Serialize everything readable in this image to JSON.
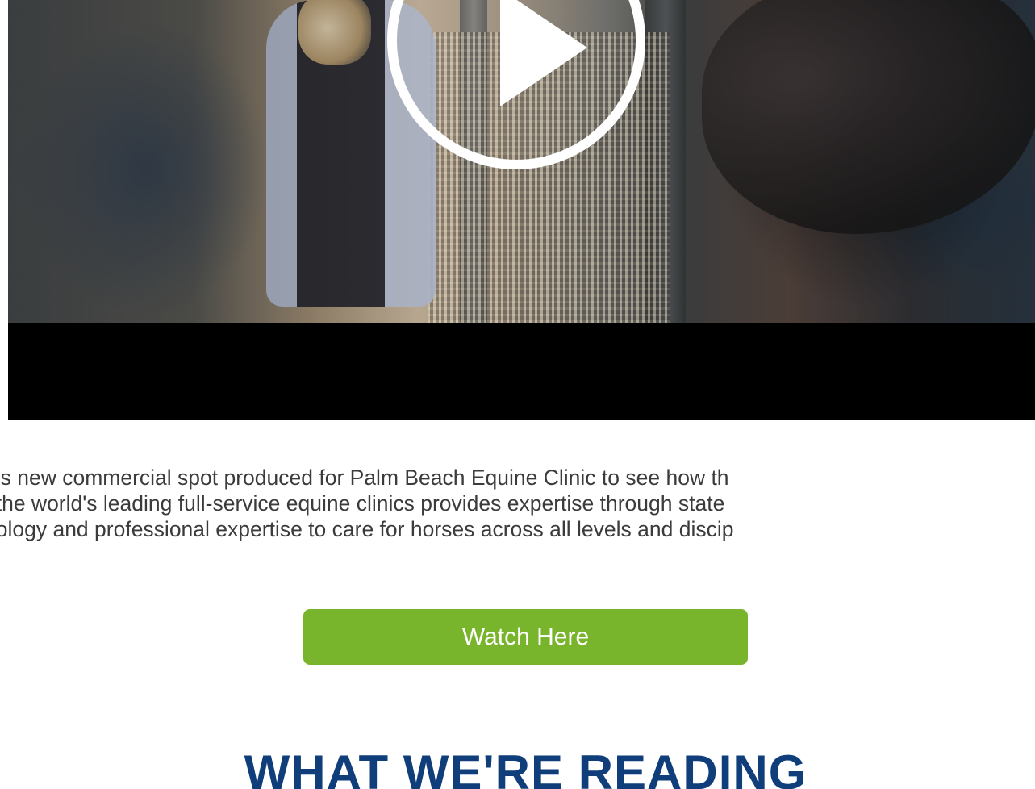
{
  "video": {
    "play_icon": "play-icon",
    "colors": {
      "letterbox": "#000000",
      "play_ring": "#ffffff"
    }
  },
  "description": {
    "lines": [
      "his new commercial spot produced for Palm Beach Equine Clinic to see how th",
      "f the world's leading full-service equine clinics provides expertise through state",
      "hology and professional expertise to care for horses across all levels and discip"
    ]
  },
  "cta": {
    "label": "Watch Here",
    "color": "#79b52c"
  },
  "section": {
    "title": "WHAT WE'RE READING",
    "color": "#0f3e7a"
  }
}
